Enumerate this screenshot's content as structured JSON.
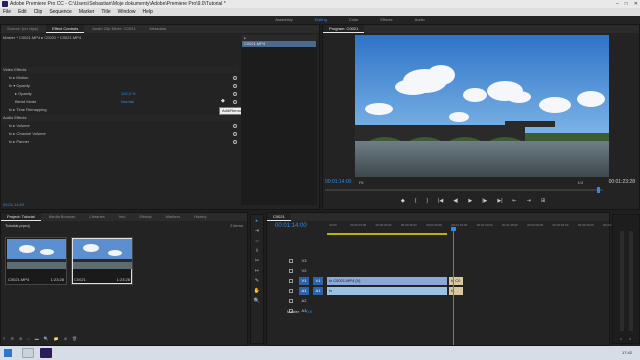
{
  "window": {
    "title": "Adobe Premiere Pro CC - C:\\Users\\Sebastian\\Moje dokumenty\\Adobe\\Premiere Pro\\9.0\\Tutorial *"
  },
  "menu": [
    "File",
    "Edit",
    "Clip",
    "Sequence",
    "Marker",
    "Title",
    "Window",
    "Help"
  ],
  "workspaces": {
    "items": [
      "Assembly",
      "Editing",
      "Color",
      "Effects",
      "Audio"
    ],
    "active_index": 1
  },
  "source_panel": {
    "tabs": [
      "Source: (no clips)",
      "Effect Controls",
      "Audio Clip Mixer: C0021",
      "Metadata"
    ],
    "active_tab_index": 1,
    "header": "Master * C0021.MP4  ▸  C0021 * C0021.MP4",
    "clip_label": "C0021.MP4",
    "rows": [
      {
        "label": "Video Effects",
        "indent": 0,
        "section": true,
        "value": ""
      },
      {
        "label": "fx ▸ Motion",
        "indent": 1,
        "section": false,
        "value": ""
      },
      {
        "label": "fx ▾ Opacity",
        "indent": 1,
        "section": false,
        "value": ""
      },
      {
        "label": "▸ Opacity",
        "indent": 2,
        "section": false,
        "value": "100,0 %"
      },
      {
        "label": "Blend Mode",
        "indent": 2,
        "section": false,
        "value": "Normal"
      },
      {
        "label": "fx ▸ Time Remapping",
        "indent": 1,
        "section": false,
        "value": ""
      },
      {
        "label": "Audio Effects",
        "indent": 0,
        "section": true,
        "value": ""
      },
      {
        "label": "fx ▸ Volume",
        "indent": 1,
        "section": false,
        "value": ""
      },
      {
        "label": "fx ▸ Channel Volume",
        "indent": 1,
        "section": false,
        "value": ""
      },
      {
        "label": "fx ▸ Panner",
        "indent": 1,
        "section": false,
        "value": ""
      }
    ],
    "tooltip": "Add/Remove Keyframe",
    "timecode": "00;01;14;00"
  },
  "program": {
    "title": "Program: C0021",
    "timecode_left": "00:01:14:00",
    "fit": "Fit",
    "quality": "1/4",
    "timecode_right": "00:01:23:28",
    "transport": [
      "◆",
      "{",
      "}",
      "|◀",
      "◀|",
      "▶",
      "|▶",
      "▶|",
      "⇤",
      "⇥",
      "⊞"
    ]
  },
  "project": {
    "tabs": [
      "Project: Tutorial",
      "Media Browser",
      "Libraries",
      "Info",
      "Effects",
      "Markers",
      "History"
    ],
    "active_tab_index": 0,
    "name": "Tutorial.prproj",
    "item_count": "2 items",
    "items": [
      {
        "name": "C0021.MP4",
        "duration": "1:23:28",
        "selected": false
      },
      {
        "name": "C0021",
        "duration": "1:23:28",
        "selected": true
      }
    ],
    "bottom": [
      "≡",
      "☰",
      "⊞",
      "○",
      "▬",
      "🔍",
      "📁",
      "⊕",
      "🗑"
    ]
  },
  "tools": [
    "▸",
    "⇥",
    "⇔",
    "◊",
    "✂",
    "↦",
    "✎",
    "✋",
    "🔍"
  ],
  "timeline": {
    "tab": "C0021",
    "timecode": "00:01:14:00",
    "ruler": [
      "00:00",
      "00:00:15:00",
      "00:00:30:00",
      "00:00:45:00",
      "00:01:00:00",
      "00:01:15:00",
      "00:01:30:00",
      "00:01:45:00",
      "00:02:00:00",
      "00:02:15:00",
      "00:02:30:00",
      "00:02:45:00"
    ],
    "tracks": [
      {
        "name": "V3",
        "kind": "video",
        "selected": false
      },
      {
        "name": "V2",
        "kind": "video",
        "selected": false
      },
      {
        "name": "V1",
        "kind": "video",
        "selected": true
      },
      {
        "name": "A1",
        "kind": "audio",
        "selected": true
      },
      {
        "name": "A2",
        "kind": "audio",
        "selected": false
      },
      {
        "name": "A3",
        "kind": "audio",
        "selected": false
      }
    ],
    "source_patch": {
      "v": "V1",
      "a": "A1"
    },
    "clips": [
      {
        "track": "V1",
        "label": "fx C0021.MP4 [V]",
        "kind": "v"
      },
      {
        "track": "V1",
        "label": "fx C0",
        "kind": "small"
      },
      {
        "track": "A1",
        "label": "fx",
        "kind": "a"
      },
      {
        "track": "A1",
        "label": "fx",
        "kind": "small"
      }
    ],
    "master": {
      "label": "Master",
      "value": "0,0"
    }
  },
  "audio_meters": {
    "labels": [
      "S",
      "S"
    ]
  },
  "taskbar": {
    "clock": "17:42"
  },
  "colors": {
    "accent": "#2d8ceb",
    "panel": "#232323",
    "bg": "#1f1f1f",
    "clip_video": "#8aa8d8"
  }
}
